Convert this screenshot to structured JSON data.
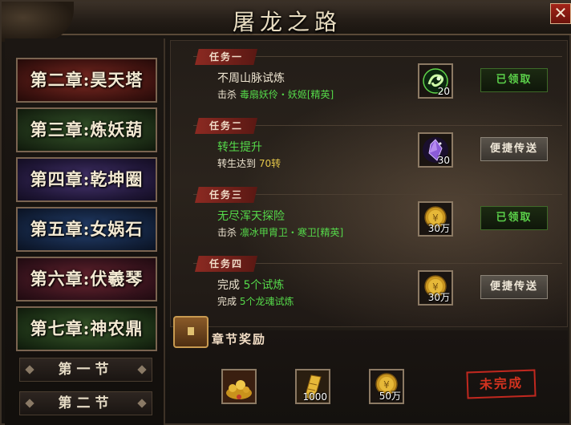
{
  "window": {
    "title": "屠龙之路",
    "close_label": "✕"
  },
  "sidebar": {
    "chapters": [
      {
        "label": "第二章:昊天塔"
      },
      {
        "label": "第三章:炼妖葫"
      },
      {
        "label": "第四章:乾坤圈"
      },
      {
        "label": "第五章:女娲石"
      },
      {
        "label": "第六章:伏羲琴"
      },
      {
        "label": "第七章:神农鼎"
      }
    ],
    "sections": [
      {
        "label": "第一节"
      },
      {
        "label": "第二节"
      }
    ]
  },
  "tasks": [
    {
      "tag": "任务一",
      "name": "不周山脉试炼",
      "detail_prefix": "击杀",
      "detail_value": "毒扇妖伶・妖姬[精英]",
      "reward_qty": "20",
      "reward_icon": "green-swirl-orb-icon",
      "action_label": "已领取",
      "action_state": "claimed"
    },
    {
      "tag": "任务二",
      "name": "转生提升",
      "detail_prefix": "转生达到",
      "detail_value": "70转",
      "reward_qty": "30",
      "reward_icon": "purple-crystal-icon",
      "action_label": "便捷传送",
      "action_state": "teleport"
    },
    {
      "tag": "任务三",
      "name": "无尽浑天探险",
      "detail_prefix": "击杀",
      "detail_value": "凛冰甲胄卫・寒卫[精英]",
      "reward_qty": "30万",
      "reward_icon": "gold-coin-icon",
      "action_label": "已领取",
      "action_state": "claimed"
    },
    {
      "tag": "任务四",
      "name_prefix": "完成",
      "name_value": "5个试炼",
      "detail_prefix": "完成",
      "detail_value": "5个龙魂试炼",
      "reward_qty": "30万",
      "reward_icon": "gold-coin-icon",
      "action_label": "便捷传送",
      "action_state": "teleport"
    }
  ],
  "chapter_reward": {
    "title": "章节奖励",
    "items": [
      {
        "icon": "treasure-pile-icon",
        "qty": ""
      },
      {
        "icon": "gold-scroll-icon",
        "qty": "1000"
      },
      {
        "icon": "gold-coin-icon",
        "qty": "50万"
      }
    ],
    "status_label": "未完成"
  },
  "colors": {
    "claimed_green": "#5bd14a",
    "highlight_green": "#55d94a",
    "status_red": "#c0281f",
    "tag_red": "#8c2a22"
  }
}
